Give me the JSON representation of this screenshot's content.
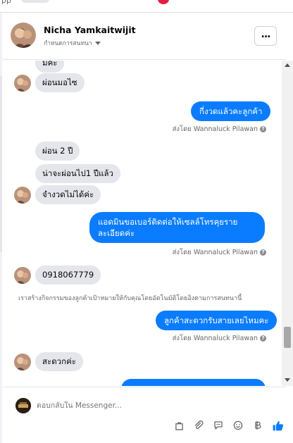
{
  "contact": {
    "name": "Nicha Yamkaitwijit",
    "sub_label": "กำหนดการสนทนา"
  },
  "header": {
    "more_label": "..."
  },
  "messages": [
    {
      "dir": "in",
      "text": "มีค่ะ"
    },
    {
      "dir": "in",
      "text": "ผ่อนมอไซ"
    },
    {
      "dir": "out",
      "text": "กี่งวดแล้วคะลูกค้า"
    },
    {
      "dir": "in",
      "text": "ผ่อน 2 ปี"
    },
    {
      "dir": "in",
      "text": "น่าจะผ่อนไป1 ปีแล้ว"
    },
    {
      "dir": "in",
      "text": "จำงวดไม่ได้ค่ะ"
    },
    {
      "dir": "out",
      "text_line1": "แอดมินขอเบอร์ติดต่อให้เซลล์โทรคุยราย",
      "text_line2": "ละเอียดค่ะ"
    },
    {
      "dir": "in",
      "text": "0918067779"
    },
    {
      "dir": "out",
      "text": "ลูกค้าสะดวกรับสายเลยไหมคะ"
    },
    {
      "dir": "in",
      "text": "สะดวกค่ะ"
    }
  ],
  "sent_by": "ส่งโดย Wannaluck Pilawan",
  "info_glyph": "?",
  "system_notice": "เราสร้างกิจกรรมของลูกค้าเป้าหมายให้กับคุณโดยอัตโนมัติโดยอิงตามการสนทนานี้",
  "composer": {
    "placeholder": "ตอบกลับใน Messenger...",
    "icons": [
      "bag-icon",
      "attachment-icon",
      "saved-reply-icon",
      "emoji-icon",
      "baht-icon",
      "like-icon"
    ]
  },
  "colors": {
    "outgoing": "#0a7cff",
    "incoming": "#e4e6eb",
    "like": "#0a7cff"
  }
}
